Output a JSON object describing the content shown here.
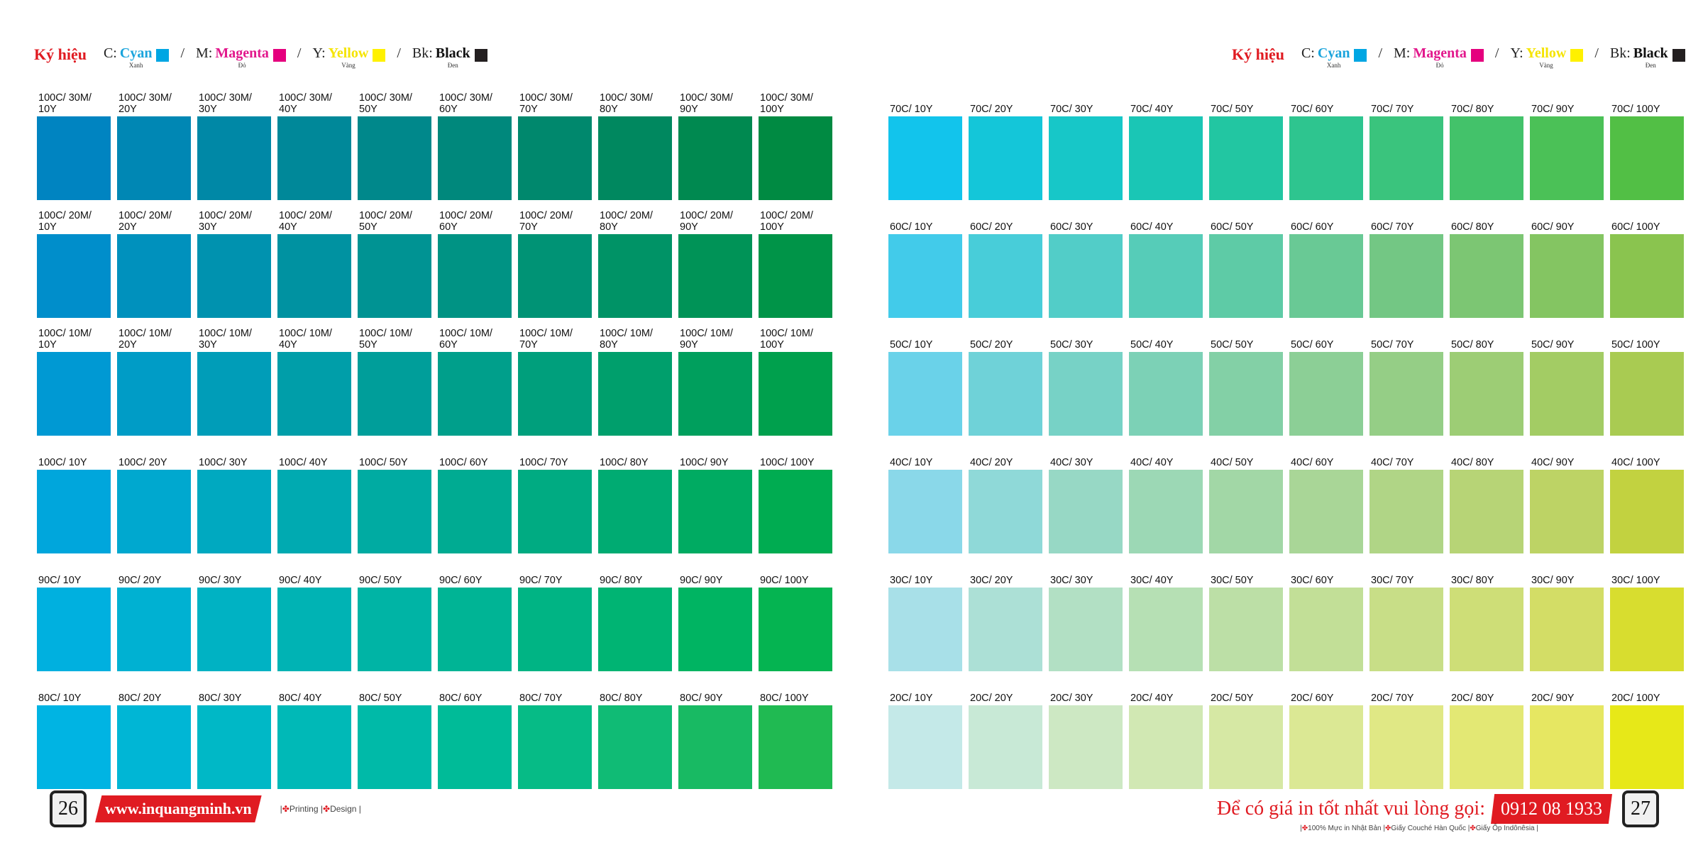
{
  "legend": {
    "title": "Ký hiệu",
    "items": [
      {
        "code": "C:",
        "name": "Cyan",
        "sub": "Xanh",
        "name_color": "#1aa4dc",
        "swatch": "#00a6e3"
      },
      {
        "code": "M:",
        "name": "Magenta",
        "sub": "Đỏ",
        "name_color": "#e2188c",
        "swatch": "#e5007e"
      },
      {
        "code": "Y:",
        "name": "Yellow",
        "sub": "Vàng",
        "name_color": "#f5e400",
        "swatch": "#fff100"
      },
      {
        "code": "Bk:",
        "name": "Black",
        "sub": "Đen",
        "name_color": "#111111",
        "swatch": "#231f20"
      }
    ],
    "separator": "/"
  },
  "left_page": {
    "page_number": "26",
    "website": "www.inquangminh.vn",
    "tagline": {
      "sep": "|",
      "cross": "✤",
      "printing": "Printing",
      "design": "Design"
    },
    "rows": [
      {
        "labels": [
          "100C/ 30M/ 10Y",
          "100C/ 30M/ 20Y",
          "100C/ 30M/ 30Y",
          "100C/ 30M/ 40Y",
          "100C/ 30M/ 50Y",
          "100C/ 30M/ 60Y",
          "100C/ 30M/ 70Y",
          "100C/ 30M/ 80Y",
          "100C/ 30M/ 90Y",
          "100C/ 30M/ 100Y"
        ],
        "colors": [
          "#0084c1",
          "#0087b4",
          "#0088a6",
          "#008899",
          "#00888b",
          "#00887c",
          "#00886d",
          "#00885f",
          "#008950",
          "#008a42"
        ]
      },
      {
        "labels": [
          "100C/ 20M/ 10Y",
          "100C/ 20M/ 20Y",
          "100C/ 20M/ 30Y",
          "100C/ 20M/ 40Y",
          "100C/ 20M/ 50Y",
          "100C/ 20M/ 60Y",
          "100C/ 20M/ 70Y",
          "100C/ 20M/ 80Y",
          "100C/ 20M/ 90Y",
          "100C/ 20M/ 100Y"
        ],
        "colors": [
          "#008ecb",
          "#0091bd",
          "#0092af",
          "#0092a1",
          "#009393",
          "#009384",
          "#009375",
          "#009366",
          "#009357",
          "#009448"
        ]
      },
      {
        "labels": [
          "100C/ 10M/ 10Y",
          "100C/ 10M/ 20Y",
          "100C/ 10M/ 30Y",
          "100C/ 10M/ 40Y",
          "100C/ 10M/ 50Y",
          "100C/ 10M/ 60Y",
          "100C/ 10M/ 70Y",
          "100C/ 10M/ 80Y",
          "100C/ 10M/ 90Y",
          "100C/ 10M/ 100Y"
        ],
        "colors": [
          "#0099d3",
          "#009cc6",
          "#009db8",
          "#009ea9",
          "#009e9a",
          "#009f8b",
          "#009f7c",
          "#009f6c",
          "#009f5d",
          "#00a04d"
        ]
      },
      {
        "labels": [
          "100C/ 10Y",
          "100C/ 20Y",
          "100C/ 30Y",
          "100C/ 40Y",
          "100C/ 50Y",
          "100C/ 60Y",
          "100C/ 70Y",
          "100C/ 80Y",
          "100C/ 90Y",
          "100C/ 100Y"
        ],
        "colors": [
          "#00a6dc",
          "#00a8cf",
          "#00a9c0",
          "#00aab1",
          "#00aba2",
          "#00ab92",
          "#00ab82",
          "#00ab72",
          "#00ab62",
          "#00ac51"
        ]
      },
      {
        "labels": [
          "90C/ 10Y",
          "90C/ 20Y",
          "90C/ 30Y",
          "90C/ 40Y",
          "90C/ 50Y",
          "90C/ 60Y",
          "90C/ 70Y",
          "90C/ 80Y",
          "90C/ 90Y",
          "90C/ 100Y"
        ],
        "colors": [
          "#00b0df",
          "#00b1d2",
          "#00b2c3",
          "#00b3b4",
          "#00b4a5",
          "#00b495",
          "#00b484",
          "#00b473",
          "#00b462",
          "#05b451"
        ]
      },
      {
        "labels": [
          "80C/ 10Y",
          "80C/ 20Y",
          "80C/ 30Y",
          "80C/ 40Y",
          "80C/ 50Y",
          "80C/ 60Y",
          "80C/ 70Y",
          "80C/ 80Y",
          "80C/ 90Y",
          "80C/ 100Y"
        ],
        "colors": [
          "#00b4e3",
          "#00b6d5",
          "#00b8c6",
          "#00b9b7",
          "#00baa8",
          "#00bb98",
          "#06bb86",
          "#10bb75",
          "#18ba63",
          "#20ba52"
        ]
      }
    ]
  },
  "right_page": {
    "page_number": "27",
    "cta": "Để có giá in tốt nhất vui lòng gọi:",
    "phone": "0912 08 1933",
    "fine_print": {
      "sep": "|",
      "cross": "✤",
      "a": "100% Mực in Nhật Bản",
      "b": "Giấy Couché Hàn Quốc",
      "c": "Giấy Ốp Indônêsia"
    },
    "rows": [
      {
        "labels": [
          "70C/ 10Y",
          "70C/ 20Y",
          "70C/ 30Y",
          "70C/ 40Y",
          "70C/ 50Y",
          "70C/ 60Y",
          "70C/ 70Y",
          "70C/ 80Y",
          "70C/ 90Y",
          "70C/ 100Y"
        ],
        "colors": [
          "#12c4ec",
          "#14c6d9",
          "#17c7c8",
          "#1ac6b5",
          "#22c6a2",
          "#2ec58f",
          "#3ac47d",
          "#43c26a",
          "#4bc157",
          "#52bf45"
        ]
      },
      {
        "labels": [
          "60C/ 10Y",
          "60C/ 20Y",
          "60C/ 30Y",
          "60C/ 40Y",
          "60C/ 50Y",
          "60C/ 60Y",
          "60C/ 70Y",
          "60C/ 80Y",
          "60C/ 90Y",
          "60C/ 100Y"
        ],
        "colors": [
          "#42cbea",
          "#48cdd9",
          "#52cdc8",
          "#56ccb8",
          "#5ecba6",
          "#69c995",
          "#73c784",
          "#7cc673",
          "#84c562",
          "#8ac44f"
        ]
      },
      {
        "labels": [
          "50C/ 10Y",
          "50C/ 20Y",
          "50C/ 30Y",
          "50C/ 40Y",
          "50C/ 50Y",
          "50C/ 60Y",
          "50C/ 70Y",
          "50C/ 80Y",
          "50C/ 90Y",
          "50C/ 100Y"
        ],
        "colors": [
          "#6ad2e9",
          "#6fd2d8",
          "#77d2c6",
          "#7cd1b6",
          "#83d0a6",
          "#8ccf96",
          "#95ce86",
          "#9dcd75",
          "#a3cc64",
          "#a9cb52"
        ]
      },
      {
        "labels": [
          "40C/ 10Y",
          "40C/ 20Y",
          "40C/ 30Y",
          "40C/ 40Y",
          "40C/ 50Y",
          "40C/ 60Y",
          "40C/ 70Y",
          "40C/ 80Y",
          "40C/ 90Y",
          "40C/ 100Y"
        ],
        "colors": [
          "#8ad8e9",
          "#8fd9d8",
          "#97d8c5",
          "#9cd8b5",
          "#a2d7a6",
          "#a9d697",
          "#b0d586",
          "#b7d476",
          "#bdd365",
          "#c2d240"
        ]
      },
      {
        "labels": [
          "30C/ 10Y",
          "30C/ 20Y",
          "30C/ 30Y",
          "30C/ 40Y",
          "30C/ 50Y",
          "30C/ 60Y",
          "30C/ 70Y",
          "30C/ 80Y",
          "30C/ 90Y",
          "30C/ 100Y"
        ],
        "colors": [
          "#a8e0e8",
          "#ace0d6",
          "#b2e0c4",
          "#b6e0b4",
          "#bcdfa6",
          "#c2df97",
          "#c8de87",
          "#cede77",
          "#d3dd66",
          "#d8dd2f"
        ]
      },
      {
        "labels": [
          "20C/ 10Y",
          "20C/ 20Y",
          "20C/ 30Y",
          "20C/ 40Y",
          "20C/ 50Y",
          "20C/ 60Y",
          "20C/ 70Y",
          "20C/ 80Y",
          "20C/ 90Y",
          "20C/ 100Y"
        ],
        "colors": [
          "#c4e9e8",
          "#c8e9d6",
          "#cde8c3",
          "#d1e8b3",
          "#d6e8a4",
          "#dbe894",
          "#e0e885",
          "#e3e874",
          "#e6e762",
          "#e7e818"
        ]
      }
    ]
  }
}
